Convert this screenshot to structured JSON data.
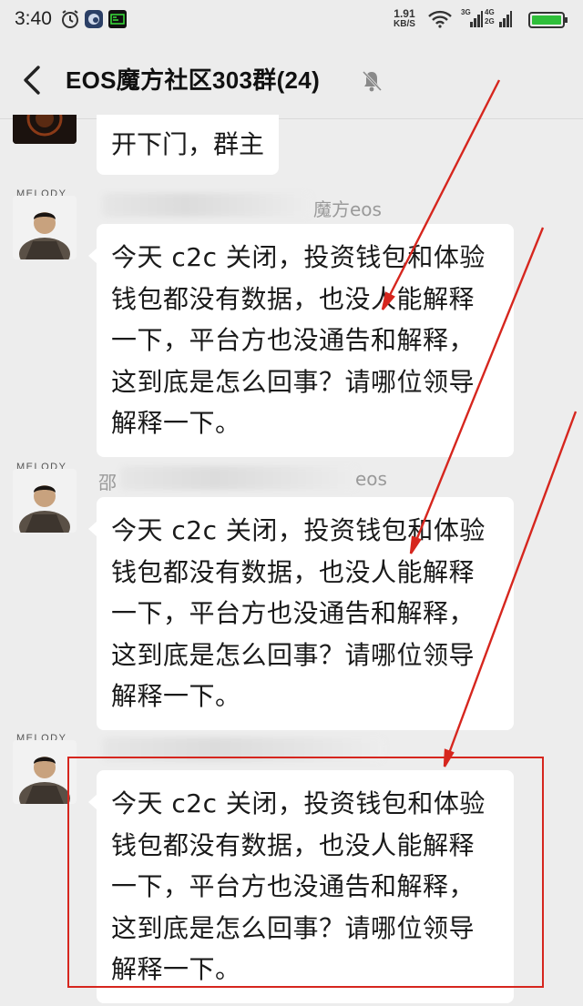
{
  "status_bar": {
    "time": "3:40",
    "speed_value": "1.91",
    "speed_unit": "KB/S",
    "net1_top": "3G",
    "net2_top": "4G",
    "net2_bottom": "2G"
  },
  "header": {
    "title": "EOS魔方社区303群(24)"
  },
  "messages": [
    {
      "text": "开下门，群主"
    },
    {
      "avatar_caption": "MELODY",
      "sender": "魔方eos",
      "lines": [
        "今天 c2c 关闭，投资钱包和体验",
        "钱包都没有数据，也没人能解释",
        "一下，平台方也没通告和解释，",
        "这到底是怎么回事？请哪位领导",
        "解释一下。"
      ]
    },
    {
      "avatar_caption": "MELODY",
      "sender_prefix": "邵",
      "sender_suffix": "eos",
      "lines": [
        "今天 c2c 关闭，投资钱包和体验",
        "钱包都没有数据，也没人能解释",
        "一下，平台方也没通告和解释，",
        "这到底是怎么回事？请哪位领导",
        "解释一下。"
      ]
    },
    {
      "avatar_caption": "MELODY",
      "lines": [
        "今天 c2c 关闭，投资钱包和体验",
        "钱包都没有数据，也没人能解释",
        "一下，平台方也没通告和解释，",
        "这到底是怎么回事？请哪位领导",
        "解释一下。"
      ]
    }
  ],
  "colors": {
    "background": "#ededed",
    "bubble": "#ffffff",
    "annotation_red": "#d6261e"
  },
  "icons": [
    "clock-icon",
    "app-icon",
    "terminal-icon",
    "wifi-icon",
    "signal-icon",
    "battery-icon",
    "back-arrow-icon",
    "mute-bell-icon"
  ]
}
